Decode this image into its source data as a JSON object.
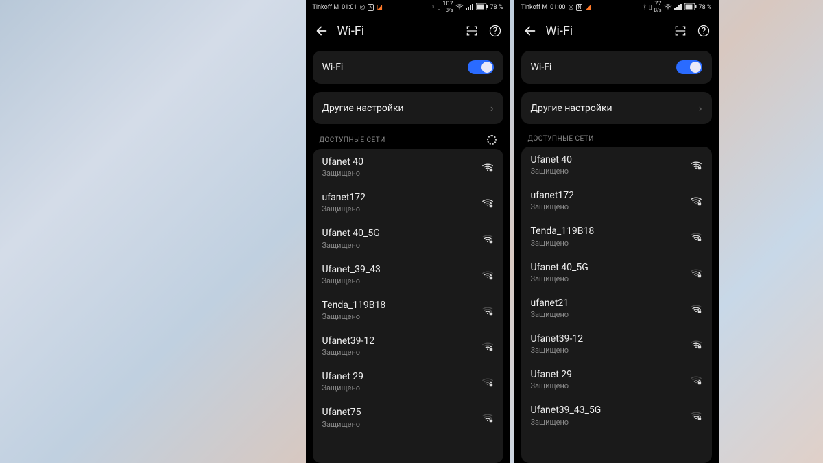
{
  "screens": [
    {
      "statusbar": {
        "carrier": "Tinkoff M",
        "time": "01:01",
        "speed": "107",
        "speedUnit": "B/s",
        "battery": "78 %"
      },
      "title": "Wi-Fi",
      "wifiRow": "Wi-Fi",
      "moreRow": "Другие настройки",
      "section": "ДОСТУПНЫЕ СЕТИ",
      "showSpinner": true,
      "networks": [
        {
          "ssid": "Ufanet 40",
          "sub": "Защищено",
          "strength": 4
        },
        {
          "ssid": "ufanet172",
          "sub": "Защищено",
          "strength": 4
        },
        {
          "ssid": "Ufanet 40_5G",
          "sub": "Защищено",
          "strength": 3
        },
        {
          "ssid": "Ufanet_39_43",
          "sub": "Защищено",
          "strength": 3
        },
        {
          "ssid": "Tenda_119B18",
          "sub": "Защищено",
          "strength": 2
        },
        {
          "ssid": "Ufanet39-12",
          "sub": "Защищено",
          "strength": 2
        },
        {
          "ssid": "Ufanet 29",
          "sub": "Защищено",
          "strength": 2
        },
        {
          "ssid": "Ufanet75",
          "sub": "Защищено",
          "strength": 2
        }
      ]
    },
    {
      "statusbar": {
        "carrier": "Tinkoff M",
        "time": "01:00",
        "speed": "77",
        "speedUnit": "B/s",
        "battery": "78 %"
      },
      "title": "Wi-Fi",
      "wifiRow": "Wi-Fi",
      "moreRow": "Другие настройки",
      "section": "ДОСТУПНЫЕ СЕТИ",
      "showSpinner": false,
      "networks": [
        {
          "ssid": "Ufanet 40",
          "sub": "Защищено",
          "strength": 4
        },
        {
          "ssid": "ufanet172",
          "sub": "Защищено",
          "strength": 4
        },
        {
          "ssid": "Tenda_119B18",
          "sub": "Защищено",
          "strength": 3
        },
        {
          "ssid": "Ufanet 40_5G",
          "sub": "Защищено",
          "strength": 3
        },
        {
          "ssid": "ufanet21",
          "sub": "Защищено",
          "strength": 3
        },
        {
          "ssid": "Ufanet39-12",
          "sub": "Защищено",
          "strength": 3
        },
        {
          "ssid": "Ufanet 29",
          "sub": "Защищено",
          "strength": 2
        },
        {
          "ssid": "Ufanet39_43_5G",
          "sub": "Защищено",
          "strength": 2
        }
      ]
    }
  ]
}
